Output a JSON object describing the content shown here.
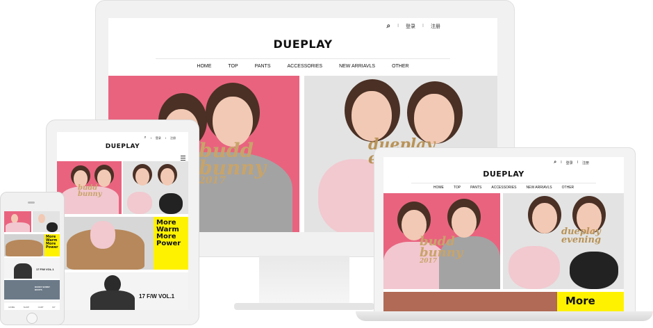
{
  "brand": "DUEPLAY",
  "utility": {
    "login": "登录",
    "register": "注册",
    "sep": "I"
  },
  "nav": [
    "HOME",
    "TOP",
    "PANTS",
    "ACCESSORIES",
    "NEW ARRIAVLS",
    "OTHER"
  ],
  "banner_script": {
    "line1": "budd",
    "line2": "bunny",
    "line3": "2017"
  },
  "banner_script_right": {
    "line1": "dueplay",
    "line2": "evening"
  },
  "promo": {
    "more_warm": "More Warm More Power",
    "line1": "More",
    "line2": "Warm",
    "line3": "More",
    "line4": "Power"
  },
  "collection": "17 F/W VOL.1",
  "phone_promo": {
    "collection": "17 F/W VOL.1",
    "banner2": "DUDDY BUNNY BOOTS"
  },
  "phone_tabs": [
    "HOME",
    "SHOP",
    "CART",
    "MY"
  ],
  "colors": {
    "pink": "#e9637f",
    "grey_bg": "#e4e4e4",
    "yellow": "#fff200",
    "hoodie_grey": "#9b9b9b",
    "hoodie_pink": "#f2c7d0",
    "device_silver": "#eeeeee"
  }
}
